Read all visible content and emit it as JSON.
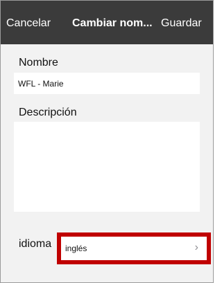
{
  "nav": {
    "cancel_label": "Cancelar",
    "title": "Cambiar nom...",
    "save_label": "Guardar"
  },
  "form": {
    "name_label": "Nombre",
    "name_value": "WFL - Marie",
    "description_label": "Descripción",
    "description_value": "",
    "language_label": "idioma",
    "language_value": "inglés"
  },
  "icons": {
    "language_chevron": "chevron-right-icon",
    "chevron_glyph": "›"
  },
  "colors": {
    "navbar_bg": "#3b3b3b",
    "highlight_border": "#c00000"
  }
}
